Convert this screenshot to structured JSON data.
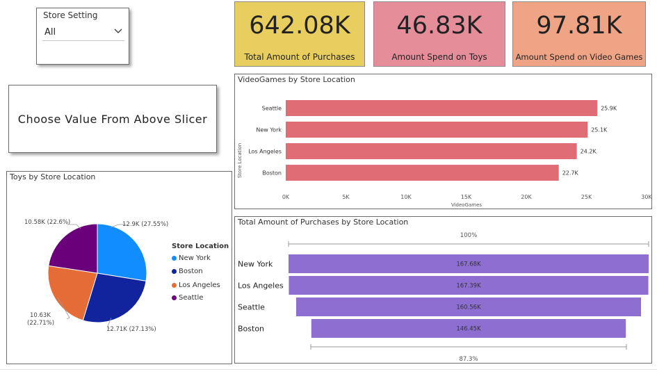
{
  "slicer": {
    "title": "Store Setting",
    "value": "All"
  },
  "kpis": [
    {
      "value": "642.08K",
      "label": "Total Amount of Purchases",
      "color": "#E8CD5F"
    },
    {
      "value": "46.83K",
      "label": "Amount Spend on Toys",
      "color": "#E58E99"
    },
    {
      "value": "97.81K",
      "label": "Amount Spend on Video Games",
      "color": "#EFA585"
    }
  ],
  "message": "Choose Value From Above Slicer",
  "toys_chart": {
    "title": "Toys by Store Location",
    "legend_title": "Store Location",
    "legend": [
      "New York",
      "Boston",
      "Los Angeles",
      "Seattle"
    ],
    "labels": [
      "12.9K (27.55%)",
      "12.71K (27.13%)",
      "10.63K",
      "(22.71%)",
      "10.58K (22.6%)"
    ]
  },
  "videogames_chart": {
    "title": "VideoGames by Store Location",
    "xlabel": "VideoGames",
    "ylabel": "Store Location",
    "ticks": [
      "0K",
      "5K",
      "10K",
      "15K",
      "20K",
      "25K",
      "30K"
    ],
    "value_labels": [
      "25.9K",
      "25.1K",
      "24.2K",
      "22.7K"
    ]
  },
  "purchases_chart": {
    "title": "Total Amount of Purchases by Store Location",
    "top_label": "100%",
    "bottom_label": "87.3%",
    "value_labels": [
      "167.68K",
      "167.39K",
      "160.56K",
      "146.45K"
    ]
  },
  "chart_data": [
    {
      "type": "pie",
      "title": "Toys by Store Location",
      "categories": [
        "New York",
        "Boston",
        "Los Angeles",
        "Seattle"
      ],
      "values": [
        12.9,
        12.71,
        10.63,
        10.58
      ],
      "percents": [
        27.55,
        27.13,
        22.71,
        22.6
      ],
      "colors": [
        "#118DFF",
        "#12239E",
        "#E66C37",
        "#6B007B"
      ],
      "legend": "right"
    },
    {
      "type": "bar",
      "orientation": "horizontal",
      "title": "VideoGames by Store Location",
      "categories": [
        "Seattle",
        "New York",
        "Los Angeles",
        "Boston"
      ],
      "values": [
        25.9,
        25.1,
        24.2,
        22.7
      ],
      "unit": "K",
      "xlabel": "VideoGames",
      "ylabel": "Store Location",
      "xlim": [
        0,
        30
      ],
      "color": "#E06C75"
    },
    {
      "type": "bar",
      "subtype": "funnel",
      "title": "Total Amount of Purchases by Store Location",
      "categories": [
        "New York",
        "Los Angeles",
        "Seattle",
        "Boston"
      ],
      "values": [
        167.68,
        167.39,
        160.56,
        146.45
      ],
      "unit": "K",
      "color": "#8E6ED0"
    }
  ]
}
